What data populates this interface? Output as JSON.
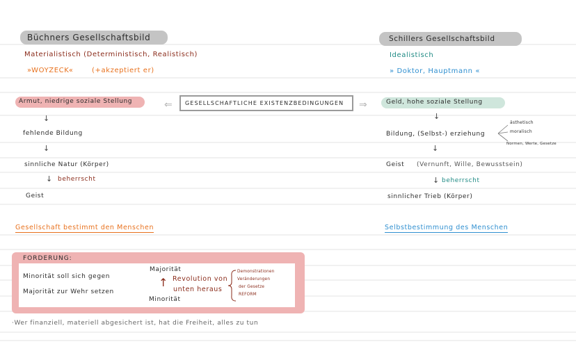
{
  "left": {
    "title": "Büchners Gesellschaftsbild",
    "subtitle": "Materialistisch (Deterministisch, Realistisch)",
    "works": "»WOYZECK«",
    "works_note": "(+akzeptiert er)",
    "item1": "Armut, niedrige soziale Stellung",
    "item2": "fehlende Bildung",
    "item3": "sinnliche Natur (Körper)",
    "item3_note": "beherrscht",
    "item4": "Geist",
    "conclusion": "Gesellschaft bestimmt den Menschen"
  },
  "center": {
    "box_label": "GESELLSCHAFTLICHE EXISTENZBEDINGUNGEN"
  },
  "right": {
    "title": "Schillers Gesellschaftsbild",
    "subtitle": "Idealistisch",
    "works": "» Doktor, Hauptmann «",
    "item1": "Geld, hohe soziale Stellung",
    "item2": "Bildung, (Selbst-) erziehung",
    "item2_branches": [
      "ästhetisch",
      "moralisch",
      "Normen, Werte, Gesetze"
    ],
    "item3": "Geist",
    "item3_note": "(Vernunft, Wille, Bewusstsein)",
    "item3_sub": "beherrscht",
    "item4": "sinnlicher Trieb (Körper)",
    "conclusion": "Selbstbestimmung des Menschen"
  },
  "forderung": {
    "heading": "FORDERUNG:",
    "line1": "Minorität soll sich gegen",
    "line2": "Majorität zur Wehr setzen",
    "top_label": "Majorität",
    "bottom_label": "Minorität",
    "revolution_line1": "Revolution von",
    "revolution_line2": "unten heraus",
    "bracket_items": [
      "Demonstrationen",
      "Veränderungen",
      "der Gesetze",
      "REFORM"
    ]
  },
  "footer": {
    "note": "·Wer finanziell, materiell abgesichert ist, hat die Freiheit, alles zu tun"
  },
  "colors": {
    "grey_highlight": "#c4c4c4",
    "pink_highlight": "#efb3b3",
    "mint_highlight": "#cfe6dc",
    "orange": "#e8711d",
    "dark_red": "#8a2b1a",
    "teal": "#1f8a84",
    "blue": "#2f8fd0"
  }
}
